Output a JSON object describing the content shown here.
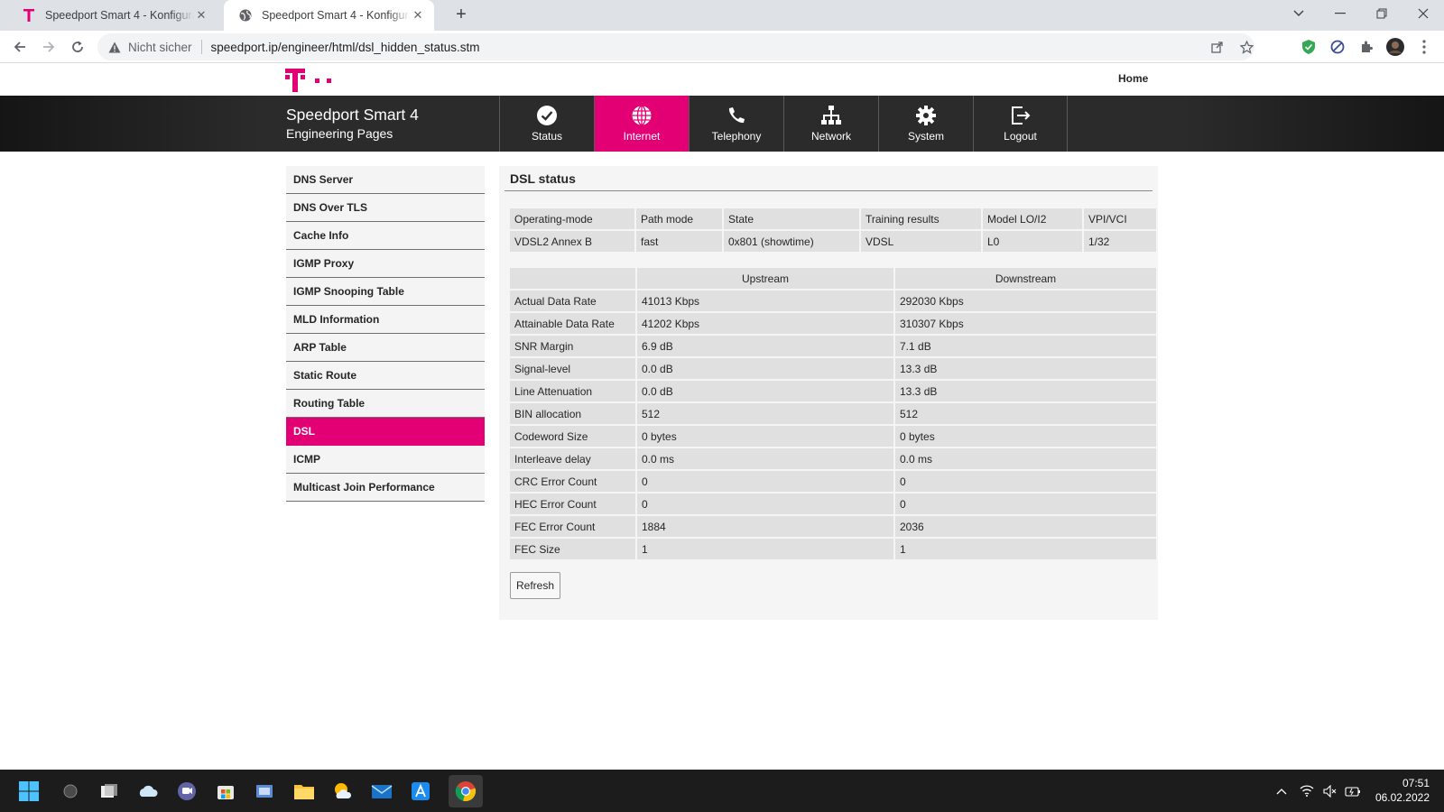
{
  "browser": {
    "tabs": [
      {
        "title": "Speedport Smart 4 - Konfiguratio",
        "close": "✕"
      },
      {
        "title": "Speedport Smart 4 - Konfiguratio",
        "close": "✕"
      }
    ],
    "new_tab": "+",
    "address": {
      "security_label": "Nicht sicher",
      "url": "speedport.ip/engineer/html/dsl_hidden_status.stm"
    }
  },
  "header": {
    "home_link": "Home",
    "brand_title": "Speedport Smart 4",
    "brand_subtitle": "Engineering Pages",
    "nav": [
      {
        "label": "Status",
        "icon": "check-circle-icon"
      },
      {
        "label": "Internet",
        "icon": "globe-icon",
        "active": true
      },
      {
        "label": "Telephony",
        "icon": "phone-icon"
      },
      {
        "label": "Network",
        "icon": "network-icon"
      },
      {
        "label": "System",
        "icon": "gear-icon"
      },
      {
        "label": "Logout",
        "icon": "logout-icon"
      }
    ],
    "accent_color": "#e20074"
  },
  "sidebar": {
    "items": [
      "DNS Server",
      "DNS Over TLS",
      "Cache Info",
      "IGMP Proxy",
      "IGMP Snooping Table",
      "MLD Information",
      "ARP Table",
      "Static Route",
      "Routing Table",
      "DSL",
      "ICMP",
      "Multicast Join Performance"
    ],
    "active": "DSL"
  },
  "main": {
    "title": "DSL status",
    "mode_table": {
      "headers": [
        "Operating-mode",
        "Path mode",
        "State",
        "Training results",
        "Model LO/I2",
        "VPI/VCI"
      ],
      "row": [
        "VDSL2 Annex B",
        "fast",
        "0x801 (showtime)",
        "VDSL",
        "L0",
        "1/32"
      ]
    },
    "stats_table": {
      "headers": [
        "",
        "Upstream",
        "Downstream"
      ],
      "rows": [
        [
          "Actual Data Rate",
          "41013 Kbps",
          "292030 Kbps"
        ],
        [
          "Attainable Data Rate",
          "41202 Kbps",
          "310307 Kbps"
        ],
        [
          "SNR Margin",
          "6.9 dB",
          "7.1 dB"
        ],
        [
          "Signal-level",
          "0.0 dB",
          "13.3 dB"
        ],
        [
          "Line Attenuation",
          "0.0 dB",
          "13.3 dB"
        ],
        [
          "BIN allocation",
          "512",
          "512"
        ],
        [
          "Codeword Size",
          "0 bytes",
          "0 bytes"
        ],
        [
          "Interleave delay",
          "0.0 ms",
          "0.0 ms"
        ],
        [
          "CRC Error Count",
          "0",
          "0"
        ],
        [
          "HEC Error Count",
          "0",
          "0"
        ],
        [
          "FEC Error Count",
          "1884",
          "2036"
        ],
        [
          "FEC Size",
          "1",
          "1"
        ]
      ]
    },
    "refresh_label": "Refresh"
  },
  "taskbar": {
    "time": "07:51",
    "date": "06.02.2022"
  }
}
